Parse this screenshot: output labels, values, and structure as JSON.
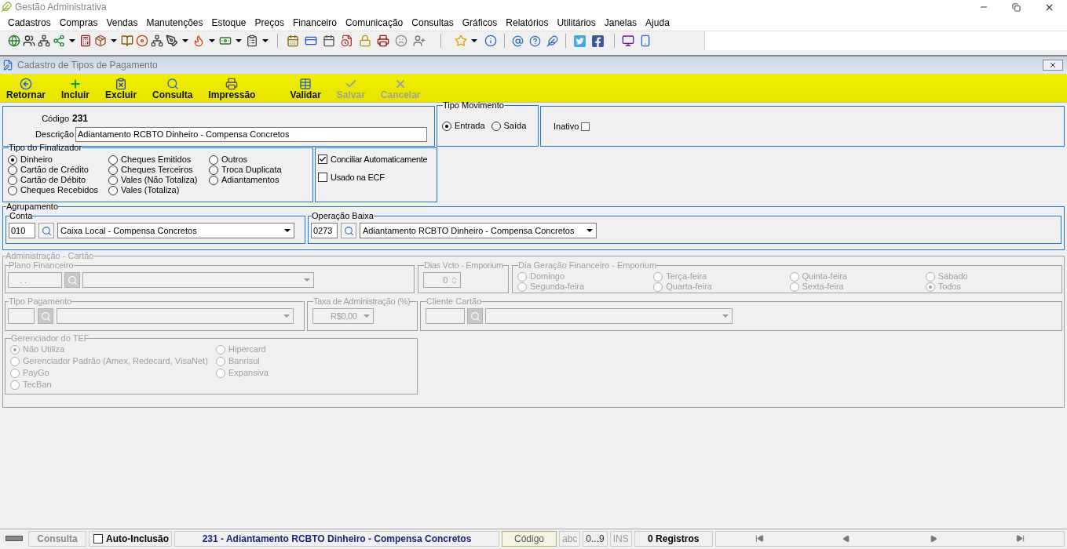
{
  "app_title": "Gestão Administrativa",
  "menu": [
    "Cadastros",
    "Compras",
    "Vendas",
    "Manutenções",
    "Estoque",
    "Preços",
    "Financeiro",
    "Comunicação",
    "Consultas",
    "Gráficos",
    "Relatórios",
    "Utilitários",
    "Janelas",
    "Ajuda"
  ],
  "form": {
    "title": "Cadastro de Tipos de Pagamento",
    "actions": [
      {
        "kind": "back",
        "label": "Retornar",
        "disabled": false
      },
      {
        "kind": "add",
        "label": "Incluir",
        "disabled": false
      },
      {
        "kind": "delete",
        "label": "Excluir",
        "disabled": false
      },
      {
        "kind": "search",
        "label": "Consulta",
        "disabled": false
      },
      {
        "kind": "print",
        "label": "Impressão",
        "disabled": false
      },
      {
        "kind": "validate",
        "label": "Validar",
        "disabled": false
      },
      {
        "kind": "save",
        "label": "Salvar",
        "disabled": true
      },
      {
        "kind": "cancel",
        "label": "Cancelar",
        "disabled": true
      }
    ],
    "codigo": {
      "label": "Código",
      "value": "231"
    },
    "descricao": {
      "label": "Descrição",
      "value": "Adiantamento RCBTO Dinheiro - Compensa Concretos"
    },
    "tipo_movimento": {
      "title": "Tipo Movimento",
      "options": [
        {
          "label": "Entrada",
          "selected": true
        },
        {
          "label": "Saída",
          "selected": false
        }
      ]
    },
    "inativo": {
      "label": "Inativo",
      "checked": false
    },
    "tipo_finalizador": {
      "title": "Tipo do Finalizador",
      "options": [
        {
          "label": "Dinheiro",
          "selected": true
        },
        {
          "label": "Cartão de Crédito",
          "selected": false
        },
        {
          "label": "Cartão de Débito",
          "selected": false
        },
        {
          "label": "Cheques Recebidos",
          "selected": false
        },
        {
          "label": "Cheques Emitidos",
          "selected": false
        },
        {
          "label": "Cheques Terceiros",
          "selected": false
        },
        {
          "label": "Vales (Não Totaliza)",
          "selected": false
        },
        {
          "label": "Vales (Totaliza)",
          "selected": false
        },
        {
          "label": "Outros",
          "selected": false
        },
        {
          "label": "Troca Duplicata",
          "selected": false
        },
        {
          "label": "Adiantamentos",
          "selected": false
        }
      ]
    },
    "flags": [
      {
        "label": "Conciliar Automaticamente",
        "checked": true
      },
      {
        "label": "Usado na ECF",
        "checked": false
      }
    ],
    "agrupamento": {
      "title": "Agrupamento",
      "conta": {
        "title": "Conta",
        "code": "010",
        "value": "Caixa Local - Compensa Concretos"
      },
      "operacao_baixa": {
        "title": "Operação Baixa",
        "code": "0273",
        "value": "Adiantamento RCBTO Dinheiro - Compensa Concretos"
      }
    },
    "administracao_cartao": {
      "title": "Administração - Cartão",
      "disabled": true,
      "plano_financeiro": {
        "title": "Plano Financeiro",
        "code": ". ."
      },
      "dias_vcto": {
        "title": "Dias Vcto - Emporium",
        "value": "0"
      },
      "dia_geracao": {
        "title": "Dia Geração Financeiro - Emporium",
        "options": [
          {
            "label": "Domingo",
            "selected": false
          },
          {
            "label": "Segunda-feira",
            "selected": false
          },
          {
            "label": "Terça-feira",
            "selected": false
          },
          {
            "label": "Quarta-feira",
            "selected": false
          },
          {
            "label": "Quinta-feira",
            "selected": false
          },
          {
            "label": "Sexta-feira",
            "selected": false
          },
          {
            "label": "Sábado",
            "selected": false
          },
          {
            "label": "Todos",
            "selected": true
          }
        ]
      },
      "tipo_pagamento": {
        "title": "Tipo Pagamento"
      },
      "taxa": {
        "title": "Taxa de Administração (%)",
        "value": "R$0,00"
      },
      "cliente_cartao": {
        "title": "Cliente Cartão"
      },
      "gerenciador_tef": {
        "title": "Gerenciador do TEF",
        "options": [
          {
            "label": "Não Utiliza",
            "selected": true
          },
          {
            "label": "Gerenciador Padrão (Amex, Redecard, VisaNet)",
            "selected": false
          },
          {
            "label": "PayGo",
            "selected": false
          },
          {
            "label": "TecBan",
            "selected": false
          },
          {
            "label": "Hipercard",
            "selected": false
          },
          {
            "label": "Banrisul",
            "selected": false
          },
          {
            "label": "Expansiva",
            "selected": false
          }
        ]
      }
    }
  },
  "status_bar": {
    "mode": "Consulta",
    "auto_inclusao": {
      "label": "Auto-Inclusão",
      "checked": false
    },
    "record": "231 - Adiantamento RCBTO Dinheiro - Compensa Concretos",
    "key_field": "Código",
    "indicators": [
      "abc",
      "0...9",
      "INS"
    ],
    "count": "0 Registros"
  }
}
